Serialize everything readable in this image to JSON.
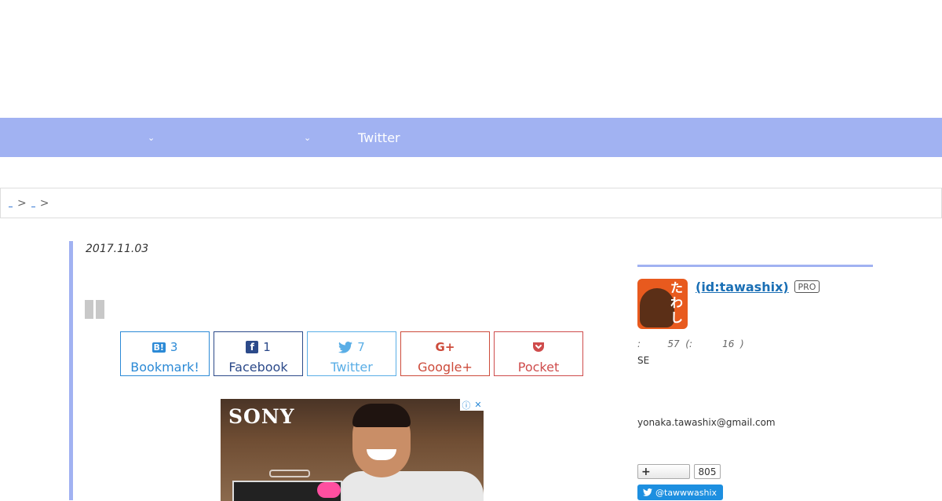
{
  "nav": {
    "items": [
      {
        "label": "",
        "chevron": "⌄"
      },
      {
        "label": "",
        "chevron": "⌄"
      },
      {
        "label": "Twitter"
      }
    ]
  },
  "breadcrumb": {
    "items": [
      "",
      ""
    ],
    "separator": ">"
  },
  "article": {
    "date": "2017.11.03"
  },
  "share": {
    "hatena": {
      "icon": "B!",
      "count": "3",
      "label": "Bookmark!"
    },
    "facebook": {
      "icon": "f",
      "count": "1",
      "label": "Facebook"
    },
    "twitter": {
      "icon": "bird-icon",
      "count": "7",
      "label": "Twitter"
    },
    "google": {
      "icon": "G+",
      "label": "Google+"
    },
    "pocket": {
      "icon": "pocket-icon",
      "label": "Pocket"
    }
  },
  "ad": {
    "brand": "SONY",
    "info_icon": "ⓘ",
    "close_icon": "✕"
  },
  "sidebar": {
    "profile_name": " (id:tawashix)",
    "badge": "PRO",
    "stats_line": ":         57  (:          16  )",
    "line_se": "SE",
    "email": "yonaka.tawashix@gmail.com",
    "follow_plus": "+",
    "follow_count": "805",
    "twitter_handle": "@tawwwashix"
  },
  "colors": {
    "accent": "#a1b2f2",
    "link": "#1a6fb5"
  }
}
